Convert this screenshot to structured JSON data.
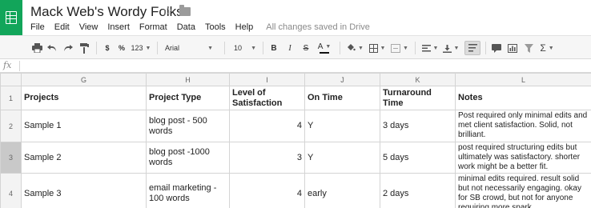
{
  "doc": {
    "title": "Mack Web's Wordy Folks"
  },
  "menu": {
    "items": [
      "File",
      "Edit",
      "View",
      "Insert",
      "Format",
      "Data",
      "Tools",
      "Help"
    ],
    "save_status": "All changes saved in Drive"
  },
  "toolbar": {
    "currency": "$",
    "percent": "%",
    "more_formats": "123",
    "font": "Arial",
    "font_size": "10",
    "bold": "B",
    "italic": "I",
    "strikethrough": "S",
    "text_color": "A",
    "sum": "Σ"
  },
  "formula_bar": {
    "label": "fx",
    "value": ""
  },
  "sheet": {
    "columns": [
      "G",
      "H",
      "I",
      "J",
      "K",
      "L"
    ],
    "row_numbers": [
      "1",
      "2",
      "3",
      "4"
    ],
    "rows": [
      [
        "Projects",
        "Project Type",
        "Level of Satisfaction",
        "On Time",
        "Turnaround Time",
        "Notes"
      ],
      [
        "Sample 1",
        "blog post - 500 words",
        "4",
        "Y",
        "3 days",
        "Post required only minimal edits and met client satisfaction. Solid, not brilliant."
      ],
      [
        "Sample 2",
        "blog post -1000 words",
        "3",
        "Y",
        "5 days",
        "post required structuring edits but ultimately was satisfactory. shorter work might be a better fit."
      ],
      [
        "Sample 3",
        "email marketing - 100 words",
        "4",
        "early",
        "2 days",
        "minimal edits required. result solid but not necessarily engaging. okay for SB crowd, but not for anyone requiring more spark."
      ]
    ]
  }
}
